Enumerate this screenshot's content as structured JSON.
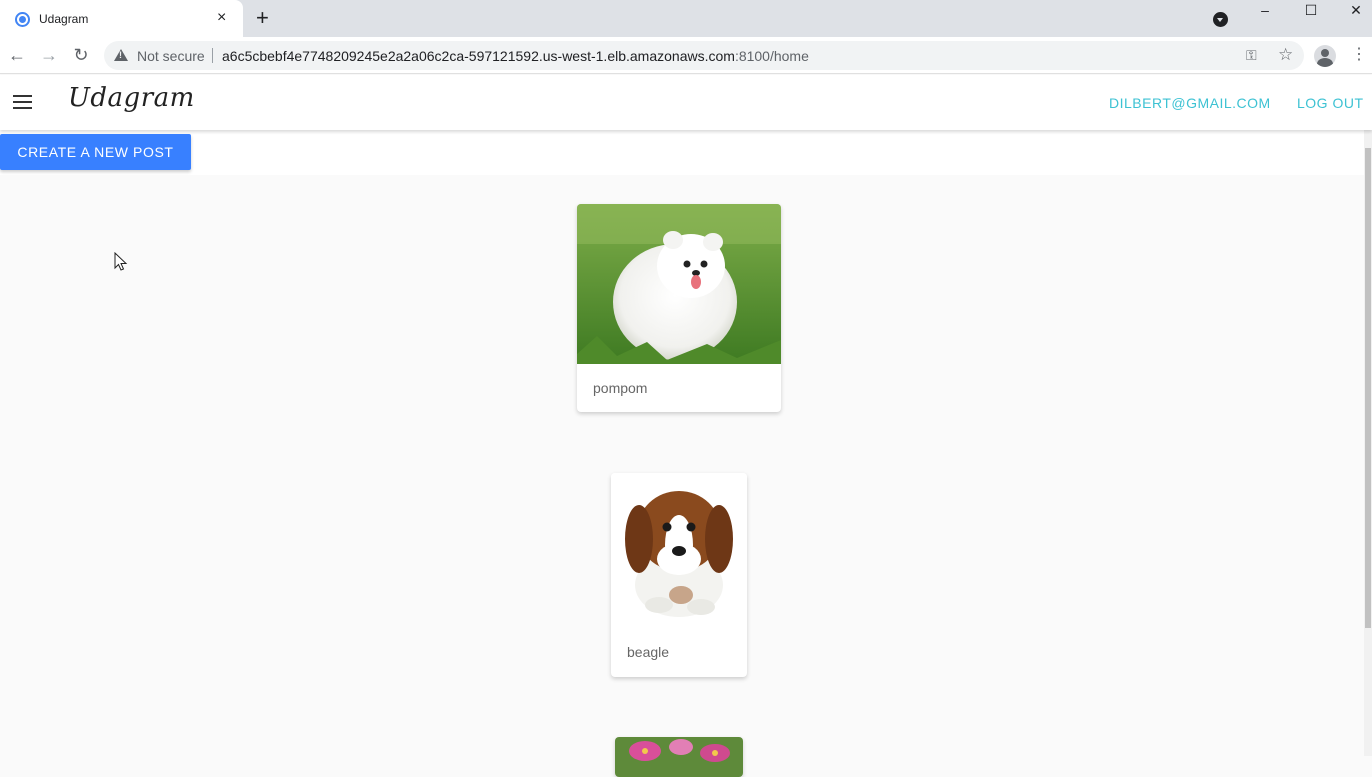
{
  "browser": {
    "tab_title": "Udagram",
    "tab_close": "×",
    "new_tab": "+",
    "security_label": "Not secure",
    "url_host": "a6c5cbebf4e7748209245e2a2a06c2ca-597121592.us-west-1.elb.amazonaws.com",
    "url_path": ":8100/home",
    "window_minimize": "–",
    "window_maximize": "☐",
    "window_close": "✕",
    "back": "←",
    "forward": "→",
    "reload": "↻"
  },
  "app": {
    "brand": "Udagram",
    "user_email": "DILBERT@GMAIL.COM",
    "logout_label": "LOG OUT",
    "create_post_label": "CREATE A NEW POST",
    "accent_color": "#3880ff",
    "link_color": "#3dc2d3"
  },
  "feed": {
    "posts": [
      {
        "caption": "pompom",
        "image": "white-pomeranian-dog-on-grass"
      },
      {
        "caption": "beagle",
        "image": "beagle-puppy-figurine"
      },
      {
        "caption": "",
        "image": "pink-flowers"
      }
    ]
  }
}
